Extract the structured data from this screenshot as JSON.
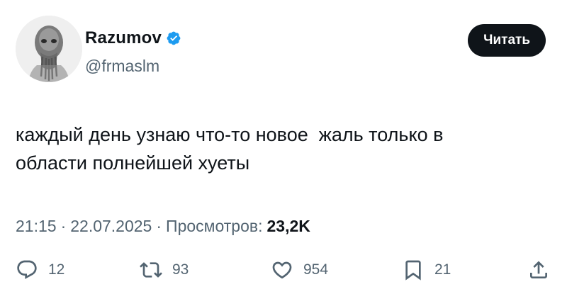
{
  "author": {
    "name": "Razumov",
    "handle": "@frmaslm",
    "verified": true,
    "avatar_icon": "gray-creature-portrait"
  },
  "follow_button_label": "Читать",
  "tweet": {
    "text": "каждый день узнаю что-то новое  жаль только в\nобласти полнейшей хуеты"
  },
  "meta": {
    "time": "21:15",
    "separator": "·",
    "date": "22.07.2025",
    "views_label": "Просмотров:",
    "views_count": "23,2K"
  },
  "actions": {
    "replies": "12",
    "retweets": "93",
    "likes": "954",
    "bookmarks": "21"
  },
  "colors": {
    "text": "#0f1419",
    "secondary": "#536471",
    "verified": "#1d9bf0",
    "button_bg": "#0f1419"
  }
}
